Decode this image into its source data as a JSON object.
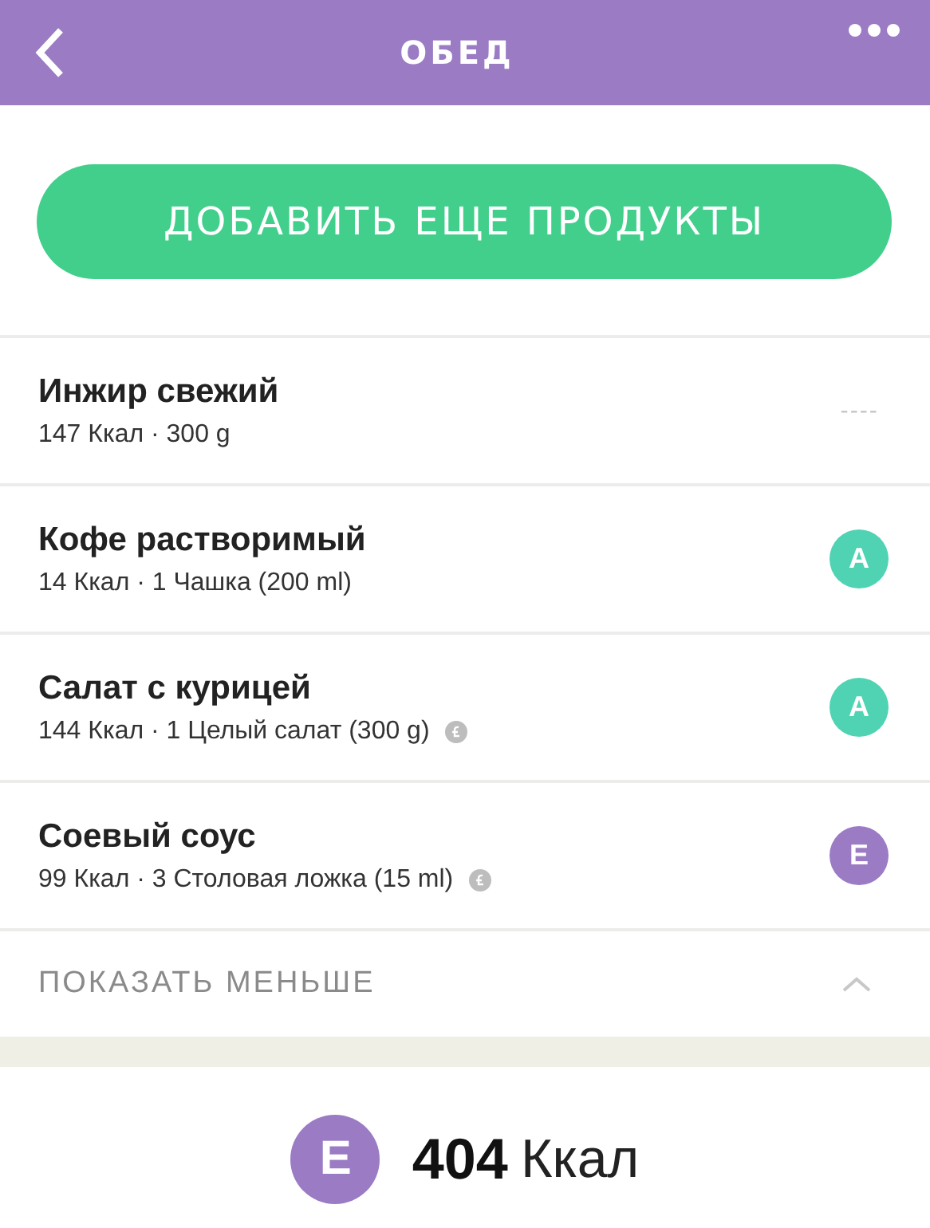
{
  "header": {
    "title": "ОБЕД"
  },
  "add_button": "ДОБАВИТЬ ЕЩЕ ПРОДУКТЫ",
  "items": [
    {
      "name": "Инжир свежий",
      "details": "147 Ккал · 300 g",
      "premium_icon": false,
      "grade_placeholder": "----"
    },
    {
      "name": "Кофе растворимый",
      "details": "14 Ккал · 1 Чашка (200 ml)",
      "premium_icon": false,
      "grade": {
        "letter": "A",
        "color": "#4fd3b3"
      }
    },
    {
      "name": "Салат с курицей",
      "details": "144 Ккал · 1 Целый салат (300 g)",
      "premium_icon": true,
      "grade": {
        "letter": "A",
        "color": "#4fd3b3"
      }
    },
    {
      "name": "Соевый соус",
      "details": "99 Ккал · 3 Столовая ложка (15 ml)",
      "premium_icon": true,
      "grade": {
        "letter": "E",
        "color": "#9a7bc4"
      }
    }
  ],
  "toggle": {
    "label": "ПОКАЗАТЬ МЕНЬШЕ",
    "expanded": true
  },
  "total": {
    "grade": {
      "letter": "E",
      "color": "#9a7bc4"
    },
    "value": "404",
    "unit": "Ккал"
  }
}
